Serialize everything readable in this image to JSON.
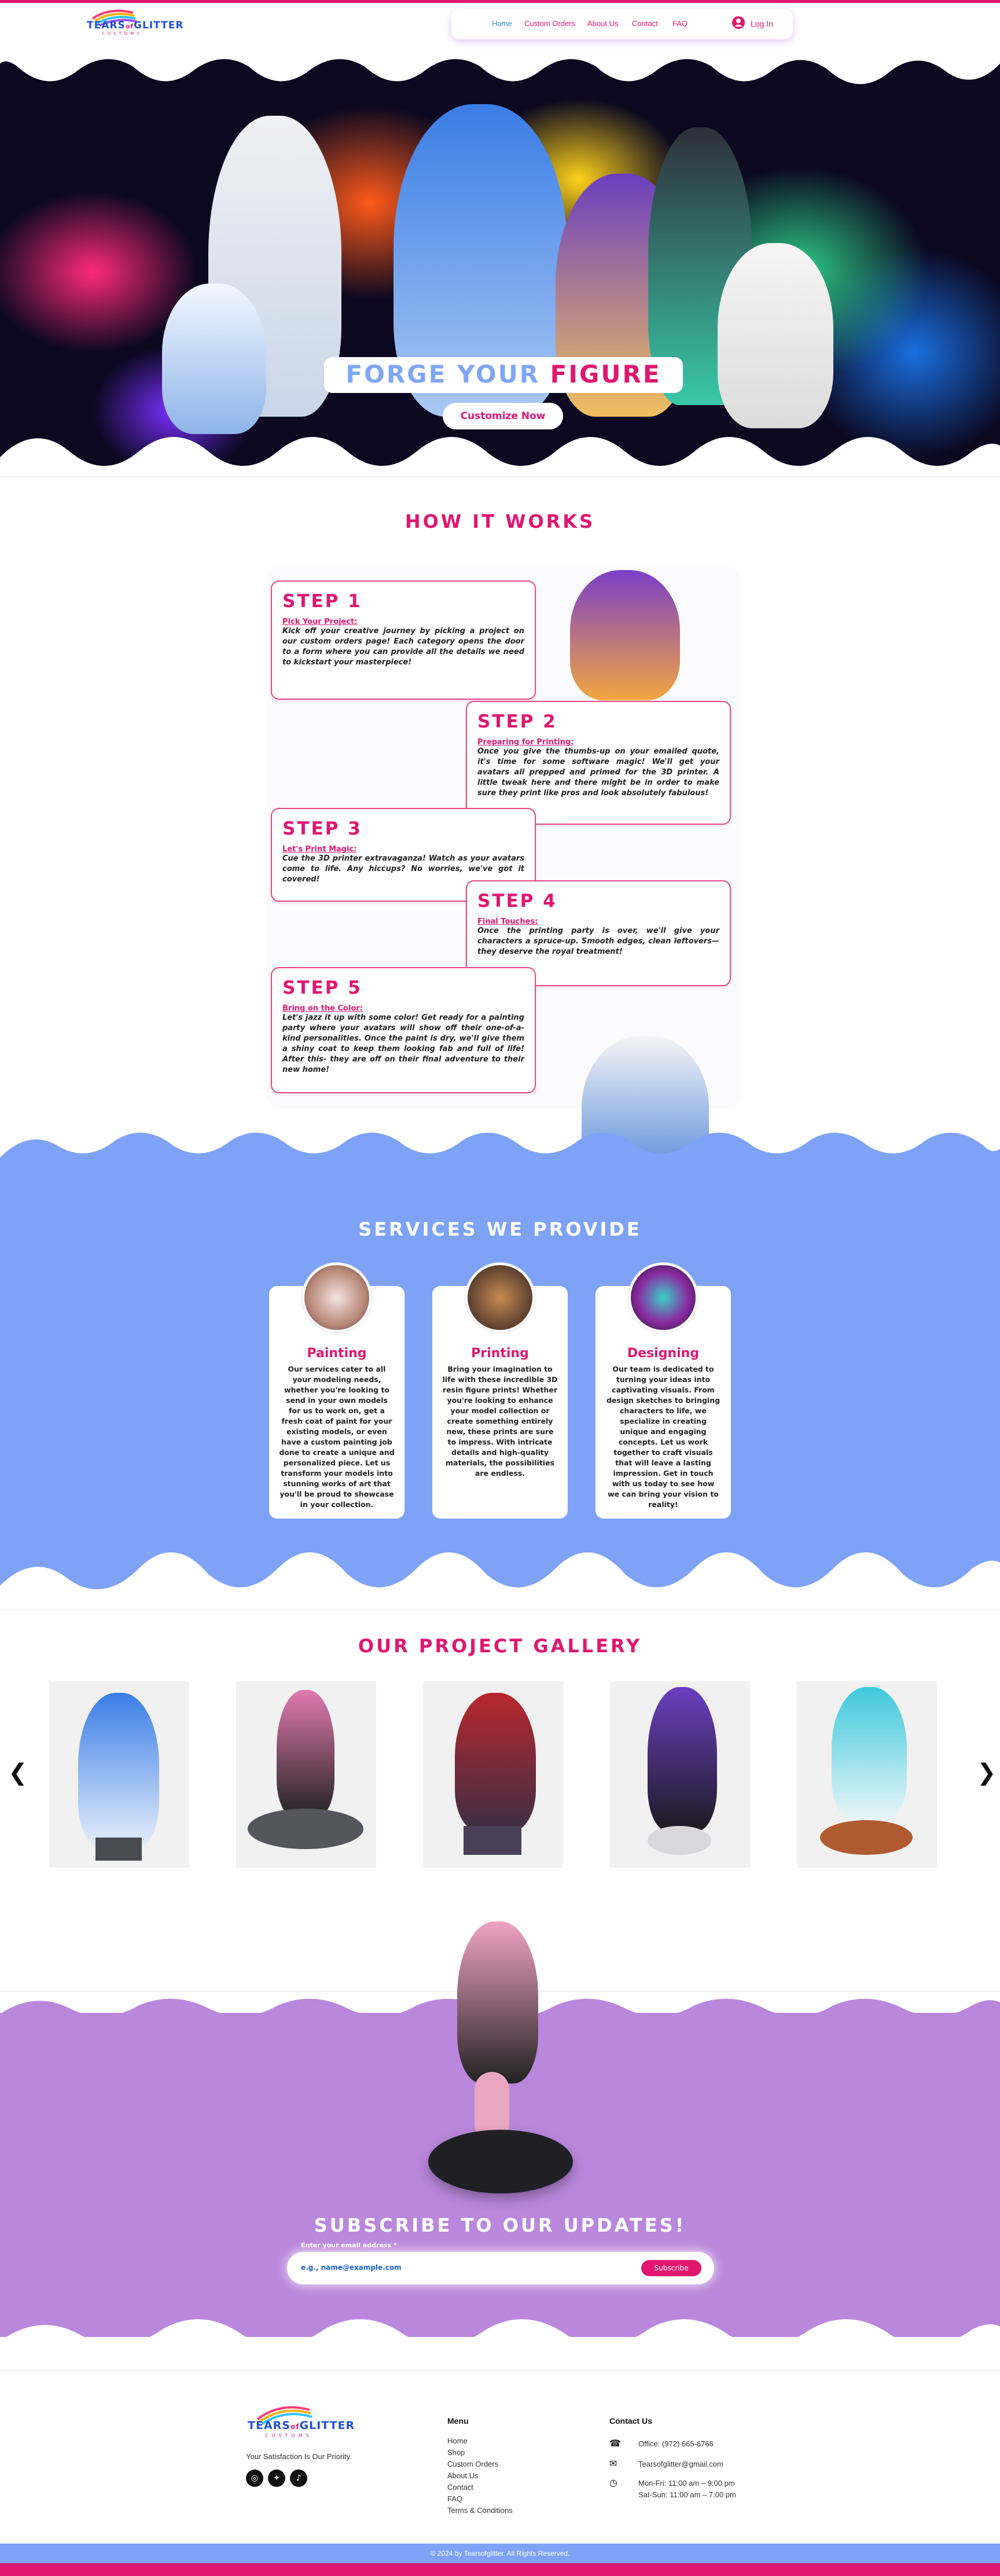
{
  "brand": {
    "logo_main": "TEARS",
    "logo_of": "of",
    "logo_second": "GLITTER",
    "logo_sub": "CUSTOMS"
  },
  "nav": {
    "items": [
      "Home",
      "Custom Orders",
      "About Us",
      "Contact",
      "FAQ"
    ],
    "login": "Log In"
  },
  "hero": {
    "title_part1": "FORGE YOUR",
    "title_part2": "FIGURE",
    "button": "Customize Now"
  },
  "how": {
    "title": "HOW IT WORKS",
    "steps": [
      {
        "title": "STEP 1",
        "sub": "Pick Your Project:",
        "text": "Kick off your creative journey by picking a project on our custom orders page! Each category opens the door to a form where you can provide all the details we need to kickstart your masterpiece!"
      },
      {
        "title": "STEP 2",
        "sub": "Preparing for Printing:",
        "text": "Once you give the thumbs-up on your emailed quote, it's time for some software magic! We'll get your avatars all prepped and primed for the 3D printer. A little tweak here and there might be in order to make sure they print like pros and look absolutely fabulous!"
      },
      {
        "title": "STEP 3",
        "sub": "Let's Print Magic:",
        "text": "Cue the 3D printer extravaganza! Watch as your avatars come to life. Any hiccups? No worries, we've got it covered!"
      },
      {
        "title": "STEP 4",
        "sub": "Final Touches:",
        "text": "Once the printing party is over, we'll give your characters a spruce-up. Smooth edges, clean leftovers—they deserve the royal treatment!"
      },
      {
        "title": "STEP 5",
        "sub": "Bring on the Color:",
        "text": "Let's jazz it up with some color! Get ready for a painting party where your avatars will show off their one-of-a-kind personalities. Once the paint is dry, we'll give them a shiny coat to keep them looking fab and full of life! After this- they are off on their final adventure to their new home!"
      }
    ]
  },
  "services": {
    "title": "SERVICES WE PROVIDE",
    "items": [
      {
        "name": "Painting",
        "text": "Our services cater to all your modeling needs, whether you're looking to send in your own models for us to work on, get a fresh coat of paint for your existing models, or even have a custom painting job done to create a unique and personalized piece. Let us transform your models into stunning works of art that you'll be proud to showcase in your collection."
      },
      {
        "name": "Printing",
        "text": "Bring your imagination to life with these incredible 3D resin figure prints! Whether you're looking to enhance your model collection or create something entirely new, these prints are sure to impress. With intricate details and high-quality materials, the possibilities are endless."
      },
      {
        "name": "Designing",
        "text": "Our team is dedicated to turning your ideas into captivating visuals. From design sketches to bringing characters to life, we specialize in creating unique and engaging concepts. Let us work together to craft visuals that will leave a lasting impression. Get in touch with us today to see how we can bring your vision to reality!"
      }
    ]
  },
  "gallery": {
    "title": "OUR PROJECT GALLERY",
    "prev": "❮",
    "next": "❯"
  },
  "subscribe": {
    "title": "SUBSCRIBE TO OUR UPDATES!",
    "label": "Enter your email address *",
    "placeholder": "e.g., name@example.com",
    "button": "Subscribe"
  },
  "footer": {
    "tagline": "Your Satisfaction Is Our Priority.",
    "menu_title": "Menu",
    "menu": [
      "Home",
      "Shop",
      "Custom Orders",
      "About Us",
      "Contact",
      "FAQ",
      "Terms & Conditions"
    ],
    "contact_title": "Contact Us",
    "phone": "Office: (972) 665-6766",
    "email": "Tearsofglitter@gmail.com",
    "hours1": "Mon-Fri: 11:00 am – 9:00 pm",
    "hours2": "Sat-Sun: 11:00 am – 7:00 pm",
    "copyright": "© 2024 by Tearsofglitter. All Rights Reserved."
  },
  "colors": {
    "pink": "#e0166f",
    "blue": "#7ea2f6",
    "purple": "#b987dc"
  }
}
